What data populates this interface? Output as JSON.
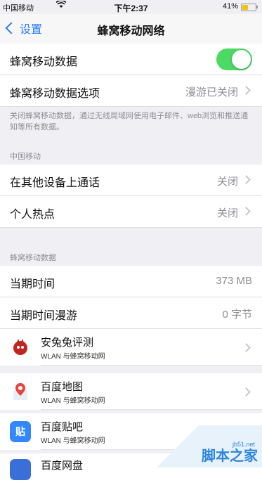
{
  "status_bar": {
    "carrier": "中国移动",
    "time": "下午2:37",
    "battery": "41%"
  },
  "nav": {
    "back_label": "设置",
    "title": "蜂窝移动网络"
  },
  "rows": {
    "cellular_data": "蜂窝移动数据",
    "cellular_data_options": "蜂窝移动数据选项",
    "cellular_data_options_value": "漫游已关闭",
    "footnote": "关闭蜂窝移动数据，通过无线局域网使用电子邮件、web浏览和推送通知等所有数据。",
    "section_carrier": "中国移动",
    "calls_other_devices": "在其他设备上通话",
    "calls_other_devices_value": "关闭",
    "personal_hotspot": "个人热点",
    "personal_hotspot_value": "关闭",
    "section_cellular_data": "蜂窝移动数据",
    "current_period": "当期时间",
    "current_period_value": "373 MB",
    "current_period_roaming": "当期时间漫游",
    "current_period_roaming_value": "0 字节"
  },
  "apps": [
    {
      "name": "安兔兔评测",
      "sub": "WLAN 与蜂窝移动网"
    },
    {
      "name": "百度地图",
      "sub": "WLAN 与蜂窝移动网"
    },
    {
      "name": "百度贴吧",
      "sub": "WLAN 与蜂窝移动网",
      "icon_text": "贴"
    },
    {
      "name": "百度网盘"
    }
  ],
  "toggle_on": true,
  "watermark": {
    "text": "脚本之家",
    "url": "jb51.net"
  }
}
